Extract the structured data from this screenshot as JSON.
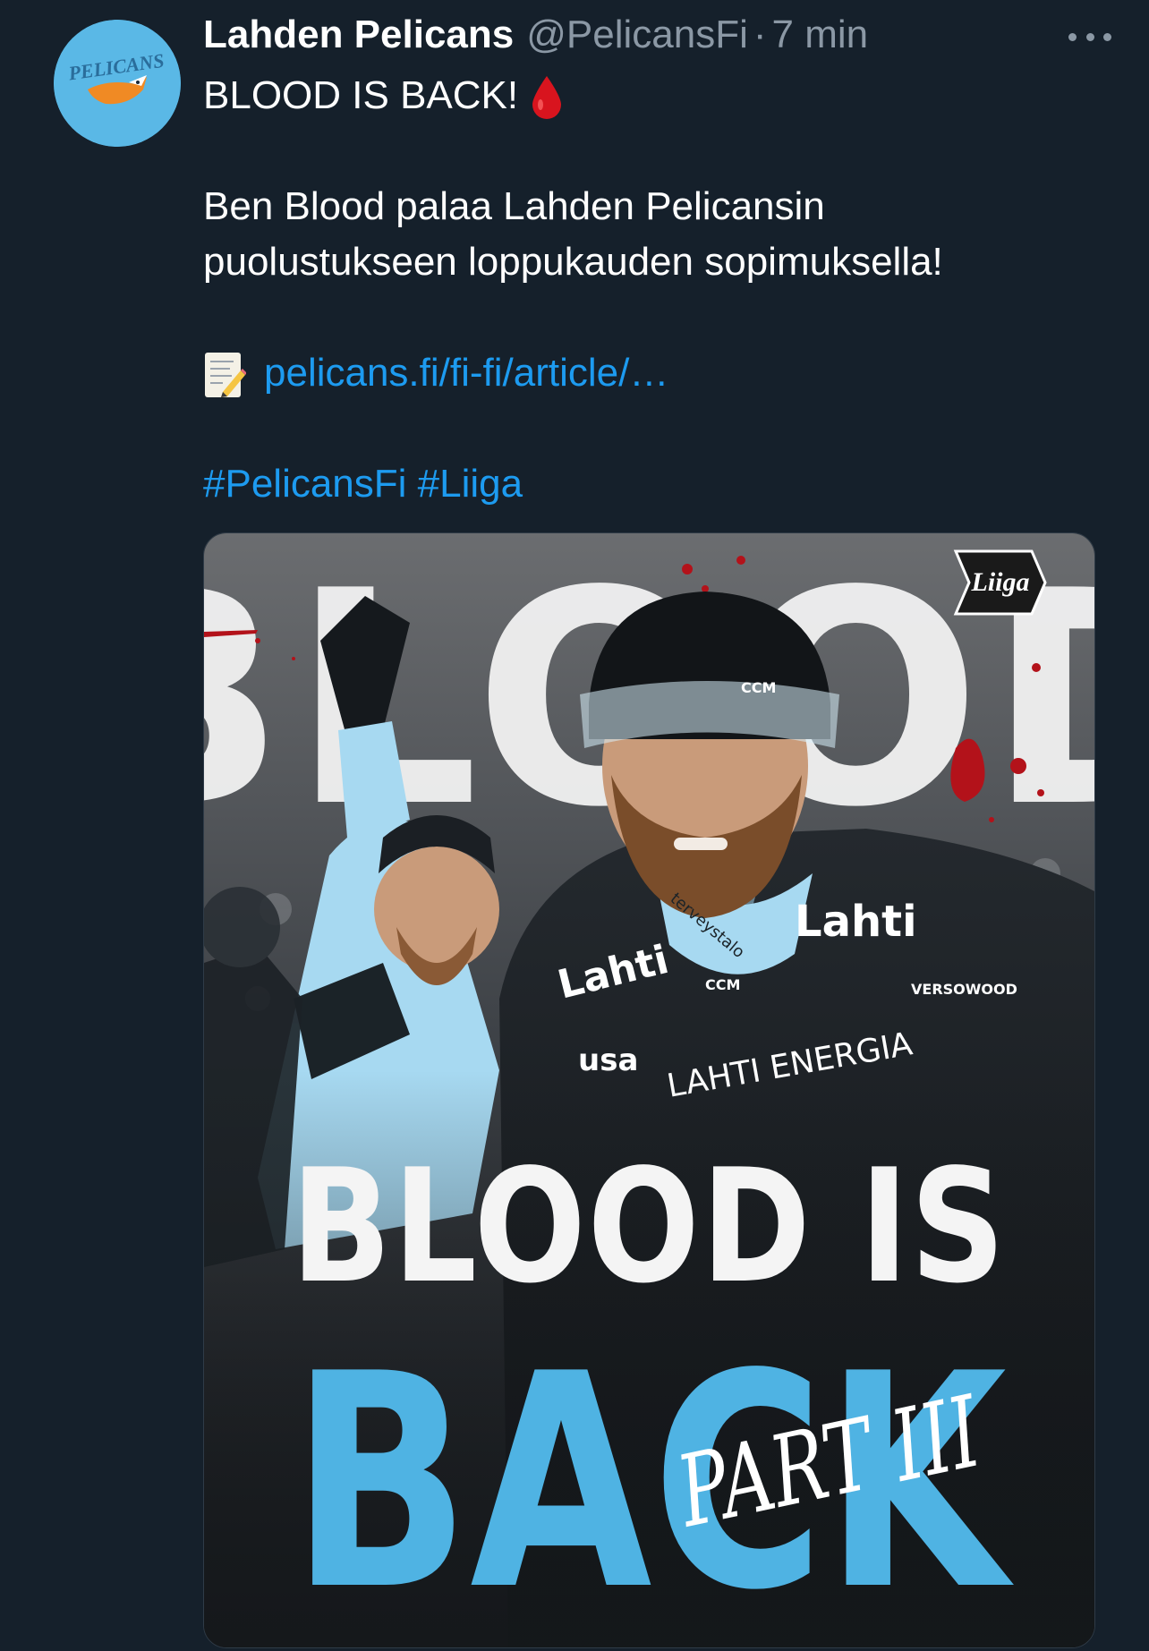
{
  "tweet": {
    "display_name": "Lahden Pelicans",
    "handle": "@PelicansFi",
    "separator": "·",
    "time": "7 min",
    "line1": "BLOOD IS BACK!",
    "line1_emoji": "drop-of-blood-icon",
    "line2a": "Ben Blood palaa Lahden Pelicansin",
    "line2b": "puolustukseen loppukauden sopimuksella!",
    "link_emoji": "memo-icon",
    "link": "pelicans.fi/fi-fi/article/…",
    "hashtags": [
      "#PelicansFi",
      "#Liiga"
    ],
    "avatar_text": "PELICANS"
  },
  "media": {
    "top_word": "BLOOD",
    "line1": "BLOOD IS",
    "line2": "BACK",
    "script": "PART III",
    "badge": "Liiga",
    "jersey_sponsor_1": "Lahti",
    "jersey_sponsor_2": "Lahti",
    "jersey_sponsor_3": "LAHTI ENERGIA",
    "jersey_sponsor_4": "VERSOWOOD",
    "jersey_collar": "terveystalo",
    "jersey_brand": "CCM",
    "jersey_small": "usa"
  },
  "colors": {
    "background": "#15202b",
    "accent": "#1d9bf0",
    "muted": "#8b98a5",
    "pelicans_blue": "#5ab8e6",
    "blood_red": "#c8102e"
  }
}
